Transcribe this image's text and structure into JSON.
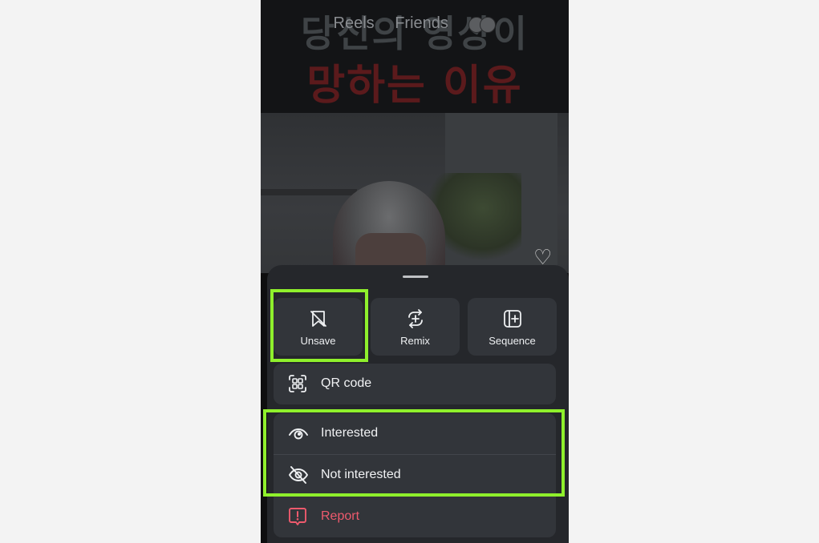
{
  "header": {
    "headline_line1": "당신의 영상이",
    "headline_line2": "망하는 이유",
    "reels_tab": "Reels",
    "friends_tab": "Friends"
  },
  "icons": {
    "like": "heart-outline-icon",
    "unsave": "bookmark-slash-icon",
    "remix": "remix-icon",
    "sequence": "sequence-add-icon",
    "qr": "qr-code-icon",
    "interested": "eye-icon",
    "not_interested": "eye-slash-icon",
    "report": "report-exclamation-icon"
  },
  "sheet": {
    "actions": [
      {
        "label": "Unsave"
      },
      {
        "label": "Remix"
      },
      {
        "label": "Sequence"
      }
    ],
    "qr_label": "QR code",
    "interested_label": "Interested",
    "not_interested_label": "Not interested",
    "report_label": "Report"
  },
  "colors": {
    "highlight": "#8ff02c",
    "danger": "#ee5a6d",
    "sheet_bg": "#25272b",
    "card_bg": "#32353a"
  }
}
